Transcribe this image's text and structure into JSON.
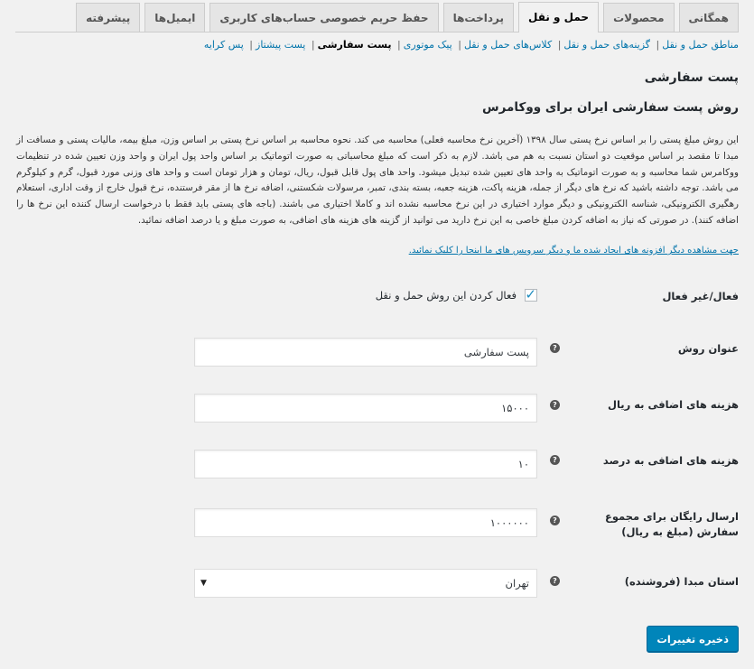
{
  "tabs": [
    {
      "label": "همگانی",
      "active": false
    },
    {
      "label": "محصولات",
      "active": false
    },
    {
      "label": "حمل و نقل",
      "active": true
    },
    {
      "label": "پرداخت‌ها",
      "active": false
    },
    {
      "label": "حفظ حریم خصوصی حساب‌های کاربری",
      "active": false
    },
    {
      "label": "ایمیل‌ها",
      "active": false
    },
    {
      "label": "پیشرفته",
      "active": false
    }
  ],
  "subnav": [
    {
      "label": "مناطق حمل و نقل",
      "current": false
    },
    {
      "label": "گزینه‌های حمل و نقل",
      "current": false
    },
    {
      "label": "کلاس‌های حمل و نقل",
      "current": false
    },
    {
      "label": "پیک موتوری",
      "current": false
    },
    {
      "label": "پست سفارشی",
      "current": true
    },
    {
      "label": "پست پیشتاز",
      "current": false
    },
    {
      "label": "پس کرایه",
      "current": false
    }
  ],
  "section_title": "پست سفارشی",
  "method_title": "روش پست سفارشی ایران برای ووکامرس",
  "description": "این روش مبلغ پستی را بر اساس نرخ پستی سال ۱۳۹۸ (آخرین نرخ محاسبه فعلی) محاسبه می کند. نحوه محاسبه بر اساس نرخ پستی بر اساس وزن، مبلغ بیمه، مالیات پستی و مسافت از مبدا تا مقصد بر اساس موقعیت دو استان نسبت به هم می باشد. لازم به ذکر است که مبلغ محاسباتی به صورت اتوماتیک بر اساس واحد پول ایران و واحد وزن تعیین شده در تنظیمات ووکامرس شما محاسبه و به صورت اتوماتیک به واحد های تعیین شده تبدیل میشود. واحد های پول قابل قبول، ریال، تومان و هزار تومان است و واحد های وزنی مورد قبول، گرم و کیلوگرم می باشد. توجه داشته باشید که نرخ های دیگر از جمله، هزینه پاکت، هزینه جعبه، بسته بندی، تمبر، مرسولات شکستنی، اضافه نرخ ها از مقر فرستنده، نرخ قبول خارج از وقت اداری، استعلام رهگیری الکترونیکی، شناسه الکترونیکی و دیگر موارد اختیاری در این نرخ محاسبه نشده اند و کاملا اختیاری می باشند. (باجه های پستی باید فقط با درخواست ارسال کننده این نرخ ها را اضافه کنند). در صورتی که نیاز به اضافه کردن مبلغ خاصی به این نرخ دارید می توانید از گزینه های هزینه های اضافی، به صورت مبلغ و یا درصد اضافه نمائید.",
  "more_link": "جهت مشاهده دیگر افزونه های ایجاد شده ما و دیگر سرویس های ما اینجا را کلیک نمائید.",
  "fields": {
    "enabled": {
      "label": "فعال/غیر فعال",
      "checkbox_label": "فعال کردن این روش حمل و نقل",
      "checked": true
    },
    "title": {
      "label": "عنوان روش",
      "value": "پست سفارشی"
    },
    "extra_cost": {
      "label": "هزینه های اضافی به ریال",
      "value": "۱۵۰۰۰"
    },
    "extra_percent": {
      "label": "هزینه های اضافی به درصد",
      "value": "۱۰"
    },
    "free_shipping": {
      "label": "ارسال رایگان برای مجموع سفارش (مبلغ به ریال)",
      "value": "۱۰۰۰۰۰۰"
    },
    "origin_state": {
      "label": "استان مبدا (فروشنده)",
      "value": "تهران"
    }
  },
  "help_glyph": "?",
  "select_arrow": "▼",
  "check_glyph": "✓",
  "save_label": "ذخیره تغییرات"
}
